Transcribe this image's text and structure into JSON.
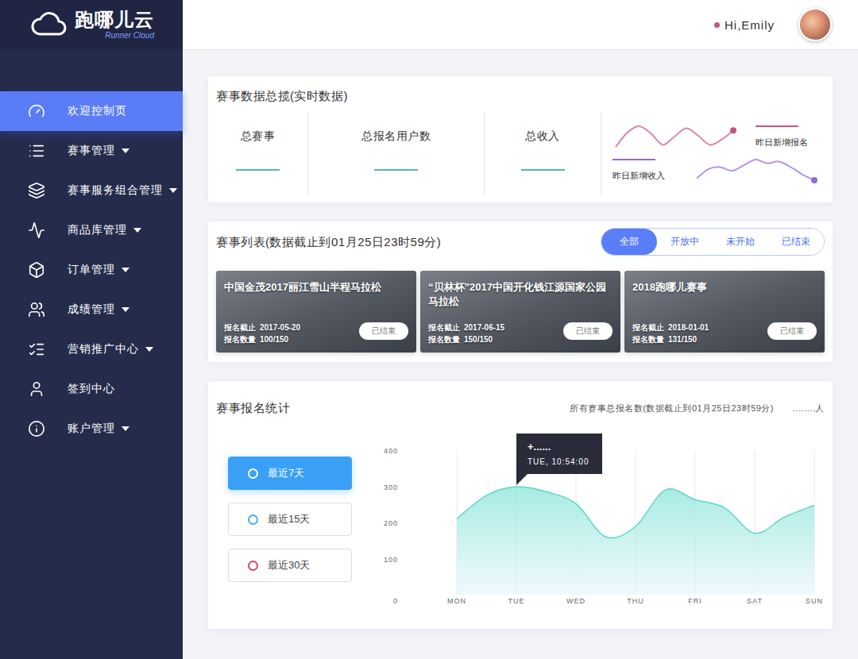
{
  "logo": {
    "name": "跑哪儿云",
    "subtitle": "Runner Cloud"
  },
  "header": {
    "greeting": "Hi,Emily"
  },
  "sidebar": {
    "items": [
      {
        "label": "欢迎控制页",
        "selected": true,
        "expandable": false
      },
      {
        "label": "赛事管理",
        "selected": false,
        "expandable": true
      },
      {
        "label": "赛事服务组合管理",
        "selected": false,
        "expandable": true
      },
      {
        "label": "商品库管理",
        "selected": false,
        "expandable": true
      },
      {
        "label": "订单管理",
        "selected": false,
        "expandable": true
      },
      {
        "label": "成绩管理",
        "selected": false,
        "expandable": true
      },
      {
        "label": "营销推广中心",
        "selected": false,
        "expandable": true
      },
      {
        "label": "签到中心",
        "selected": false,
        "expandable": false
      },
      {
        "label": "账户管理",
        "selected": false,
        "expandable": true
      }
    ]
  },
  "overview": {
    "title": "赛事数据总揽(实时数据)",
    "stats": [
      {
        "label": "总赛事"
      },
      {
        "label": "总报名用户数"
      },
      {
        "label": "总收入"
      }
    ],
    "trends": [
      {
        "label": "昨日新增报名",
        "color": "#c9557a",
        "values": [
          20,
          34,
          40,
          33,
          22,
          30,
          38,
          31,
          22,
          27,
          36
        ]
      },
      {
        "label": "昨日新增收入",
        "color": "#9466d8",
        "values": [
          18,
          28,
          30,
          26,
          32,
          38,
          34,
          36,
          30,
          22,
          16
        ]
      }
    ]
  },
  "events": {
    "title": "赛事列表(数据截止到01月25日23时59分)",
    "filters": [
      {
        "label": "全部",
        "selected": true
      },
      {
        "label": "开放中",
        "selected": false
      },
      {
        "label": "未开始",
        "selected": false
      },
      {
        "label": "已结束",
        "selected": false
      }
    ],
    "items": [
      {
        "title": "中国金茂2017丽江雪山半程马拉松",
        "deadline_label": "报名截止",
        "deadline": "2017-05-20",
        "count_label": "报名数量",
        "count": "100/150",
        "status": "已结束"
      },
      {
        "title": "“贝林杯”2017中国开化钱江源国家公园马拉松",
        "deadline_label": "报名截止",
        "deadline": "2017-06-15",
        "count_label": "报名数量",
        "count": "150/150",
        "status": "已结束"
      },
      {
        "title": "2018跑哪儿赛事",
        "deadline_label": "报名截止",
        "deadline": "2018-01-01",
        "count_label": "报名数量",
        "count": "131/150",
        "status": "已结束"
      }
    ]
  },
  "registrations": {
    "title": "赛事报名统计",
    "summary": "所有赛事总报名数(数据截止到01月25日23时59分)",
    "total": "........人",
    "ranges": [
      {
        "label": "最近7天",
        "selected": true,
        "color": "#3aa0f5"
      },
      {
        "label": "最近15天",
        "selected": false,
        "color": "#4aa8f0"
      },
      {
        "label": "最近30天",
        "selected": false,
        "color": "#d9456a"
      }
    ],
    "chart": {
      "y_max": 400,
      "y_ticks": [
        "400",
        "300",
        "200",
        "100",
        "0"
      ],
      "x_labels": [
        "MON",
        "TUE",
        "WED",
        "THU",
        "FRI",
        "SAT",
        "SUN"
      ],
      "series": [
        {
          "values": [
            210,
            275,
            299,
            285,
            252,
            160,
            189,
            290,
            263,
            240,
            170,
            215,
            248
          ]
        }
      ],
      "tooltip": {
        "point_index": 2,
        "value": "+......",
        "time": "TUE, 10:54:00"
      }
    }
  }
}
